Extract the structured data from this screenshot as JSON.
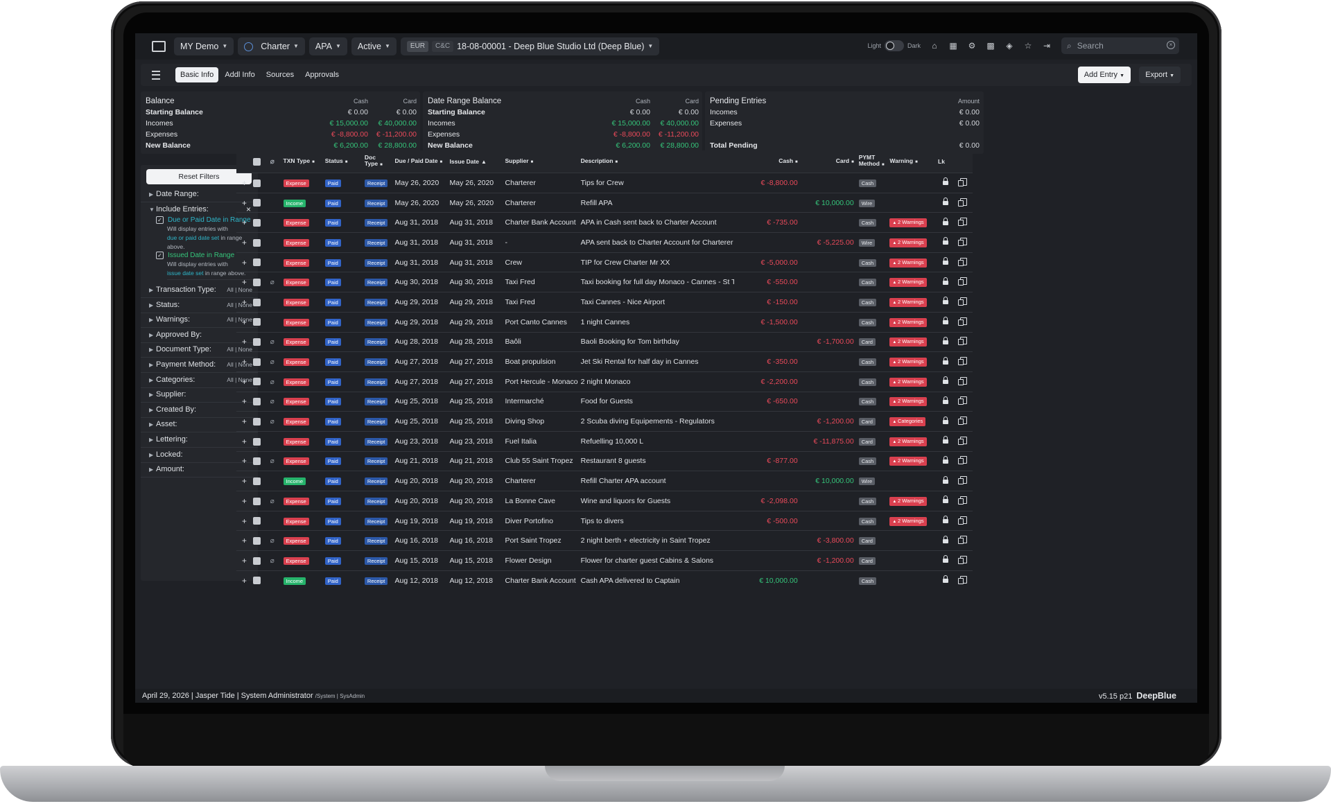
{
  "topbar": {
    "company": "MY Demo",
    "type": "Charter",
    "account": "APA",
    "state": "Active",
    "cur1": "EUR",
    "cur2": "C&C",
    "entity": "18-08-00001 - Deep Blue Studio Ltd (Deep Blue)",
    "light_label": "Light",
    "dark_label": "Dark",
    "search_placeholder": "Search"
  },
  "tabs": [
    "Basic Info",
    "Addl Info",
    "Sources",
    "Approvals"
  ],
  "buttons": {
    "add_entry": "Add Entry",
    "export": "Export"
  },
  "balance": {
    "title": "Balance",
    "col_cash": "Cash",
    "col_card": "Card",
    "rows": [
      {
        "label": "Starting Balance",
        "cash": "€ 0.00",
        "card": "€ 0.00"
      },
      {
        "label": "Incomes",
        "cash": "€ 15,000.00",
        "card": "€ 40,000.00"
      },
      {
        "label": "Expenses",
        "cash": "€ -8,800.00",
        "card": "€ -11,200.00"
      },
      {
        "label": "New Balance",
        "cash": "€ 6,200.00",
        "card": "€ 28,800.00"
      }
    ]
  },
  "range_balance": {
    "title": "Date Range Balance",
    "col_cash": "Cash",
    "col_card": "Card",
    "rows": [
      {
        "label": "Starting Balance",
        "cash": "€ 0.00",
        "card": "€ 0.00"
      },
      {
        "label": "Incomes",
        "cash": "€ 15,000.00",
        "card": "€ 40,000.00"
      },
      {
        "label": "Expenses",
        "cash": "€ -8,800.00",
        "card": "€ -11,200.00"
      },
      {
        "label": "New Balance",
        "cash": "€ 6,200.00",
        "card": "€ 28,800.00"
      }
    ]
  },
  "pending": {
    "title": "Pending Entries",
    "col_amount": "Amount",
    "incomes_label": "Incomes",
    "incomes": "€ 0.00",
    "expenses_label": "Expenses",
    "expenses": "€ 0.00",
    "total_label": "Total Pending",
    "total": "€ 0.00"
  },
  "filters": {
    "reset": "Reset Filters",
    "date_range": "Date Range:",
    "include": "Include Entries:",
    "opt1": "Due or Paid Date in Range",
    "opt1_note_a": "Will display entries with",
    "opt1_note_b": "due or paid date set",
    "opt1_note_c": " in range",
    "opt1_note_d": "above.",
    "opt2": "Issued Date in Range",
    "opt2_note_a": "Will display entries with",
    "opt2_note_b": "issue date set",
    "opt2_note_c": " in range above.",
    "all_none": "All | None",
    "groups": [
      "Transaction Type:",
      "Status:",
      "Warnings:",
      "Approved By:",
      "Document Type:",
      "Payment Method:",
      "Categories:",
      "Supplier:",
      "Created By:",
      "Asset:",
      "Lettering:",
      "Locked:",
      "Amount:"
    ],
    "groups_allnone": [
      true,
      true,
      true,
      false,
      true,
      true,
      true,
      false,
      false,
      false,
      false,
      false,
      false
    ]
  },
  "table": {
    "headers": {
      "txn_type": "TXN Type",
      "status": "Status",
      "doc_type": "Doc Type",
      "due_paid": "Due / Paid Date",
      "issue": "Issue Date",
      "supplier": "Supplier",
      "description": "Description",
      "cash": "Cash",
      "card": "Card",
      "pymt": "PYMT Method",
      "warning": "Warning",
      "lk": "Lk"
    },
    "rows": [
      {
        "type": "Expense",
        "status": "Paid",
        "doc": "Receipt",
        "due": "May 26, 2020",
        "issue": "May 26, 2020",
        "supplier": "Charterer",
        "desc": "Tips for Crew",
        "cash": "€ -8,800.00",
        "card": "",
        "pm": "Cash",
        "warn": "",
        "clip": false
      },
      {
        "type": "Income",
        "status": "Paid",
        "doc": "Receipt",
        "due": "May 26, 2020",
        "issue": "May 26, 2020",
        "supplier": "Charterer",
        "desc": "Refill APA",
        "cash": "",
        "card": "€ 10,000.00",
        "pm": "Wire",
        "warn": "",
        "clip": false
      },
      {
        "type": "Expense",
        "status": "Paid",
        "doc": "Receipt",
        "due": "Aug 31, 2018",
        "issue": "Aug 31, 2018",
        "supplier": "Charter Bank Account",
        "desc": "APA in Cash sent back to Charter Account",
        "cash": "€ -735.00",
        "card": "",
        "pm": "Cash",
        "warn": "2 Warnings",
        "clip": false
      },
      {
        "type": "Expense",
        "status": "Paid",
        "doc": "Receipt",
        "due": "Aug 31, 2018",
        "issue": "Aug 31, 2018",
        "supplier": "-",
        "desc": "APA sent back to Charter Account for Charterer",
        "cash": "",
        "card": "€ -5,225.00",
        "pm": "Wire",
        "warn": "2 Warnings",
        "clip": false
      },
      {
        "type": "Expense",
        "status": "Paid",
        "doc": "Receipt",
        "due": "Aug 31, 2018",
        "issue": "Aug 31, 2018",
        "supplier": "Crew",
        "desc": "TIP for Crew Charter Mr XX",
        "cash": "€ -5,000.00",
        "card": "",
        "pm": "Cash",
        "warn": "2 Warnings",
        "clip": false
      },
      {
        "type": "Expense",
        "status": "Paid",
        "doc": "Receipt",
        "due": "Aug 30, 2018",
        "issue": "Aug 30, 2018",
        "supplier": "Taxi Fred",
        "desc": "Taxi booking for full day Monaco - Cannes - St Tropez",
        "cash": "€ -550.00",
        "card": "",
        "pm": "Cash",
        "warn": "2 Warnings",
        "clip": true
      },
      {
        "type": "Expense",
        "status": "Paid",
        "doc": "Receipt",
        "due": "Aug 29, 2018",
        "issue": "Aug 29, 2018",
        "supplier": "Taxi Fred",
        "desc": "Taxi Cannes - Nice Airport",
        "cash": "€ -150.00",
        "card": "",
        "pm": "Cash",
        "warn": "2 Warnings",
        "clip": false
      },
      {
        "type": "Expense",
        "status": "Paid",
        "doc": "Receipt",
        "due": "Aug 29, 2018",
        "issue": "Aug 29, 2018",
        "supplier": "Port Canto Cannes",
        "desc": "1 night Cannes",
        "cash": "€ -1,500.00",
        "card": "",
        "pm": "Cash",
        "warn": "2 Warnings",
        "clip": false
      },
      {
        "type": "Expense",
        "status": "Paid",
        "doc": "Receipt",
        "due": "Aug 28, 2018",
        "issue": "Aug 28, 2018",
        "supplier": "Baôli",
        "desc": "Baoli Booking for Tom birthday",
        "cash": "",
        "card": "€ -1,700.00",
        "pm": "Card",
        "warn": "2 Warnings",
        "clip": true
      },
      {
        "type": "Expense",
        "status": "Paid",
        "doc": "Receipt",
        "due": "Aug 27, 2018",
        "issue": "Aug 27, 2018",
        "supplier": "Boat propulsion",
        "desc": "Jet Ski Rental for half day in Cannes",
        "cash": "€ -350.00",
        "card": "",
        "pm": "Cash",
        "warn": "2 Warnings",
        "clip": true
      },
      {
        "type": "Expense",
        "status": "Paid",
        "doc": "Receipt",
        "due": "Aug 27, 2018",
        "issue": "Aug 27, 2018",
        "supplier": "Port Hercule - Monaco",
        "desc": "2 night Monaco",
        "cash": "€ -2,200.00",
        "card": "",
        "pm": "Cash",
        "warn": "2 Warnings",
        "clip": true
      },
      {
        "type": "Expense",
        "status": "Paid",
        "doc": "Receipt",
        "due": "Aug 25, 2018",
        "issue": "Aug 25, 2018",
        "supplier": "Intermarché",
        "desc": "Food for Guests",
        "cash": "€ -650.00",
        "card": "",
        "pm": "Cash",
        "warn": "2 Warnings",
        "clip": true
      },
      {
        "type": "Expense",
        "status": "Paid",
        "doc": "Receipt",
        "due": "Aug 25, 2018",
        "issue": "Aug 25, 2018",
        "supplier": "Diving Shop",
        "desc": "2 Scuba diving Equipements - Regulators",
        "cash": "",
        "card": "€ -1,200.00",
        "pm": "Card",
        "warn": "Categories",
        "clip": true
      },
      {
        "type": "Expense",
        "status": "Paid",
        "doc": "Receipt",
        "due": "Aug 23, 2018",
        "issue": "Aug 23, 2018",
        "supplier": "Fuel Italia",
        "desc": "Refuelling 10,000 L",
        "cash": "",
        "card": "€ -11,875.00",
        "pm": "Card",
        "warn": "2 Warnings",
        "clip": false
      },
      {
        "type": "Expense",
        "status": "Paid",
        "doc": "Receipt",
        "due": "Aug 21, 2018",
        "issue": "Aug 21, 2018",
        "supplier": "Club 55 Saint Tropez",
        "desc": "Restaurant 8 guests",
        "cash": "€ -877.00",
        "card": "",
        "pm": "Cash",
        "warn": "2 Warnings",
        "clip": true
      },
      {
        "type": "Income",
        "status": "Paid",
        "doc": "Receipt",
        "due": "Aug 20, 2018",
        "issue": "Aug 20, 2018",
        "supplier": "Charterer",
        "desc": "Refill Charter APA account",
        "cash": "",
        "card": "€ 10,000.00",
        "pm": "Wire",
        "warn": "",
        "clip": false
      },
      {
        "type": "Expense",
        "status": "Paid",
        "doc": "Receipt",
        "due": "Aug 20, 2018",
        "issue": "Aug 20, 2018",
        "supplier": "La Bonne Cave",
        "desc": "Wine and liquors for Guests",
        "cash": "€ -2,098.00",
        "card": "",
        "pm": "Cash",
        "warn": "2 Warnings",
        "clip": true
      },
      {
        "type": "Expense",
        "status": "Paid",
        "doc": "Receipt",
        "due": "Aug 19, 2018",
        "issue": "Aug 19, 2018",
        "supplier": "Diver Portofino",
        "desc": "Tips to divers",
        "cash": "€ -500.00",
        "card": "",
        "pm": "Cash",
        "warn": "2 Warnings",
        "clip": false
      },
      {
        "type": "Expense",
        "status": "Paid",
        "doc": "Receipt",
        "due": "Aug 16, 2018",
        "issue": "Aug 16, 2018",
        "supplier": "Port Saint Tropez",
        "desc": "2 night berth + electricity in Saint Tropez",
        "cash": "",
        "card": "€ -3,800.00",
        "pm": "Card",
        "warn": "",
        "clip": true
      },
      {
        "type": "Expense",
        "status": "Paid",
        "doc": "Receipt",
        "due": "Aug 15, 2018",
        "issue": "Aug 15, 2018",
        "supplier": "Flower Design",
        "desc": "Flower for charter guest Cabins & Salons",
        "cash": "",
        "card": "€ -1,200.00",
        "pm": "Card",
        "warn": "",
        "clip": true
      },
      {
        "type": "Income",
        "status": "Paid",
        "doc": "Receipt",
        "due": "Aug 12, 2018",
        "issue": "Aug 12, 2018",
        "supplier": "Charter Bank Account",
        "desc": "Cash APA delivered to Captain",
        "cash": "€ 10,000.00",
        "card": "",
        "pm": "Cash",
        "warn": "",
        "clip": false
      }
    ]
  },
  "footer": {
    "left": "April 29, 2026 | Jasper Tide | System Administrator",
    "left_small": "/System | SysAdmin",
    "version": "v5.15 p21",
    "brand": "DeepBlue"
  },
  "icons": [
    "menu-icon",
    "globe-icon",
    "home-icon",
    "calendar-icon",
    "gear-icon",
    "grid-icon",
    "tag-icon",
    "star-icon",
    "logout-icon",
    "search-icon",
    "paperclip-icon",
    "lock-icon",
    "copy-icon"
  ]
}
